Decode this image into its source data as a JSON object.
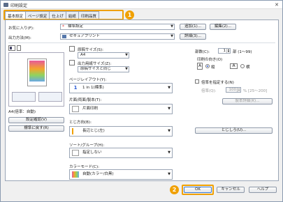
{
  "window": {
    "title": "印刷設定"
  },
  "tabs": [
    "基本設定",
    "ページ設定",
    "仕上げ",
    "給紙",
    "印刷品質"
  ],
  "badges": {
    "first": "1",
    "second": "2"
  },
  "favorites": {
    "label": "お気に入り(F):",
    "value": "標準設定",
    "add_btn": "追加(1)...",
    "edit_btn": "編集(2)..."
  },
  "output": {
    "label": "出力方法(M):",
    "value": "セキュアプリント",
    "detail_btn": "詳細(3)..."
  },
  "preview": {
    "caption": "A4(倍率：自動)",
    "settings_btn": "設定確認(V)",
    "restore_btn": "標準に戻す(R)"
  },
  "paper": {
    "size_label": "原稿サイズ(S):",
    "size_value": "A4",
    "out_label": "出力用紙サイズ(Z):",
    "out_value": "原稿サイズと同じ",
    "copies_label": "部数(C):",
    "copies_value": "1",
    "copies_range": "部 (1～99)",
    "orient_label": "印刷の向き(O)",
    "orient_portrait": "縦",
    "orient_landscape": "横"
  },
  "layout": {
    "label": "ページレイアウト(Y):",
    "value": "1 in 1(標準)"
  },
  "scale": {
    "check_label": "倍率を指定する(N)",
    "ratio_label": "倍率(Q):",
    "ratio_value": "100",
    "ratio_range": "% [25～200]"
  },
  "duplex": {
    "label": "片面/両面/製本(T):",
    "value": "片面印刷",
    "binding_btn": "製本詳細(K)..."
  },
  "binding": {
    "label": "とじ方向(B):",
    "value": "長辺とじ(左)",
    "margin_btn": "とじしろ(U)..."
  },
  "sort": {
    "label": "ソート/グループ(H):",
    "value": "指定しない"
  },
  "color": {
    "label": "カラーモード(C):",
    "value": "自動(カラー/白黒)"
  },
  "footer": {
    "ok": "OK",
    "cancel": "キャンセル",
    "help": "ヘルプ"
  },
  "colors": {
    "accent": "#f0a000",
    "selection": "#2a5bd7"
  }
}
